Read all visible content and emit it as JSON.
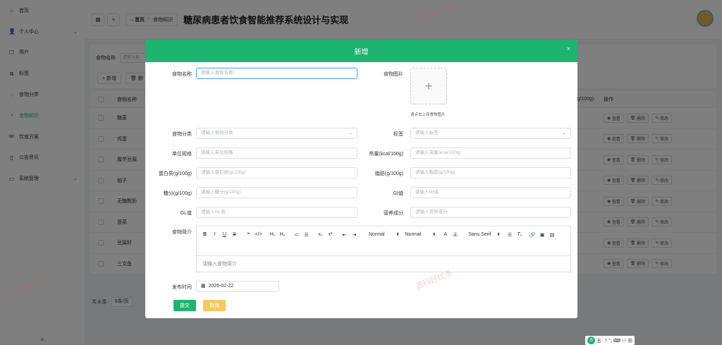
{
  "app_title": "糖尿病患者饮食智能推荐系统设计与实现",
  "sidebar": {
    "items": [
      {
        "label": "首页",
        "icon": "home-icon",
        "glyph": "⌂"
      },
      {
        "label": "个人中心",
        "icon": "user-icon",
        "glyph": "👤",
        "has_arrow": true
      },
      {
        "label": "用户",
        "icon": "user-edit-icon",
        "glyph": "☐"
      },
      {
        "label": "标签",
        "icon": "tag-icon",
        "glyph": "⧉"
      },
      {
        "label": "食物分类",
        "icon": "chat-icon",
        "glyph": "◌"
      },
      {
        "label": "食物知识",
        "icon": "clock-icon",
        "glyph": "◔",
        "active": true
      },
      {
        "label": "饮食方案",
        "icon": "mail-icon",
        "glyph": "✉"
      },
      {
        "label": "公告资讯",
        "icon": "book-icon",
        "glyph": "▯"
      },
      {
        "label": "系统管理",
        "icon": "settings-icon",
        "glyph": "▭",
        "has_arrow": true
      }
    ],
    "bottom_glyph": "≡"
  },
  "topbar": {
    "home": "首页",
    "current": "食物知识"
  },
  "background": {
    "search_label": "食物名称",
    "search_placeholder": "请输入食",
    "add_label": "+ 新增",
    "delete_label": "删",
    "col_name": "食物名称",
    "col_right": "(g/100g)",
    "col_ops": "操作",
    "rows": [
      "糖麦",
      "鸡蛋",
      "魔芋豆腐",
      "柚子",
      "无糖酸奶",
      "菠菜",
      "豆腐籽",
      "三文鱼"
    ],
    "op_view": "查看",
    "op_delete": "删除",
    "op_edit": "修改",
    "total": "共 8 条",
    "page_size": "8条/页"
  },
  "modal": {
    "title": "新增",
    "close_glyph": "×",
    "fields": {
      "name_label": "食物名称",
      "name_placeholder": "请输入食物名称",
      "image_label": "食物图片",
      "upload_tip": "请点击上传食物图片",
      "category_label": "食物分类",
      "category_placeholder": "请输入食物分类",
      "tag_label": "标签",
      "tag_placeholder": "请输入标签",
      "unit_label": "单位规格",
      "unit_placeholder": "请输入单位规格",
      "calorie_label": "热量(kcal/100g)",
      "calorie_placeholder": "请输入热量(kcal/100g)",
      "protein_label": "蛋白质(g/100g)",
      "protein_placeholder": "请输入蛋白质(g/100g)",
      "fat_label": "脂肪(g/100g)",
      "fat_placeholder": "请输入脂肪(g/100g)",
      "sugar_label": "糖分(g/100g)",
      "sugar_placeholder": "请输入糖分(g/100g)",
      "gi_label": "GI值",
      "gi_placeholder": "请输入GI值",
      "gl_label": "GL值",
      "gl_placeholder": "请输入GL值",
      "nutrition_label": "营养成分",
      "nutrition_placeholder": "请输入营养成分",
      "intro_label": "食物简介",
      "intro_placeholder": "请输入食物简介",
      "date_label": "发布时间",
      "date_value": "2026-02-22"
    },
    "editor": {
      "size1": "Normal",
      "size2": "Normal",
      "font": "Sans Serif"
    },
    "submit": "提交",
    "cancel": "取消"
  },
  "watermark": "源码好优多",
  "ime": {
    "logo": "S",
    "text": "五 ☽ °, ⌨ ⚇ ▦"
  },
  "colors": {
    "accent": "#1cb46f",
    "cancel": "#f4c95d"
  }
}
